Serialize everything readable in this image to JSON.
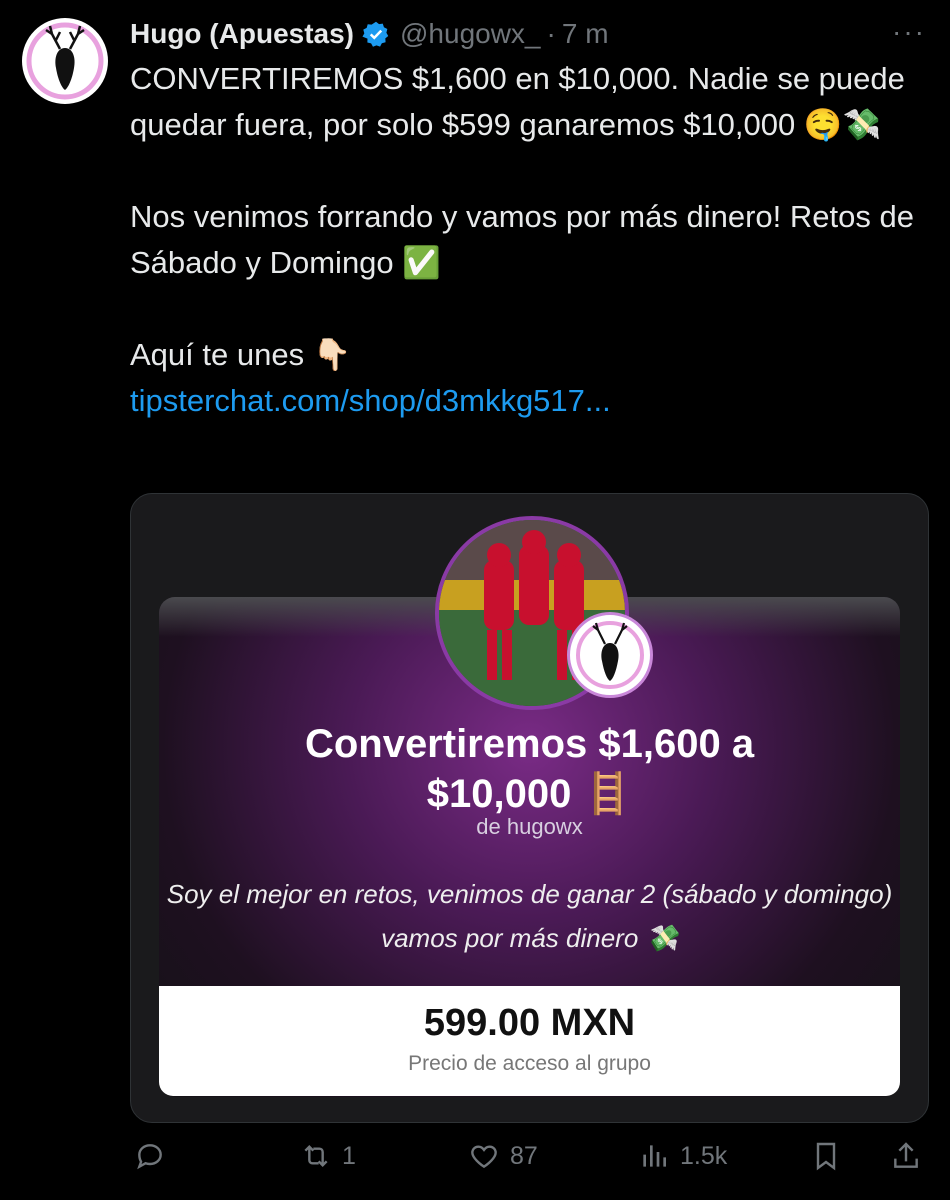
{
  "author": {
    "name": "Hugo (Apuestas)",
    "handle": "@hugowx_",
    "separator": "·",
    "time": "7 m",
    "verified": true,
    "avatar_icon": "deer-logo-icon"
  },
  "more_label": "···",
  "tweet": {
    "text": "CONVERTIREMOS $1,600 en $10,000. Nadie se puede quedar fuera, por solo $599 ganaremos $10,000 🤤💸\n\nNos venimos forrando y vamos por más dinero! Retos de Sábado y Domingo ✅\n\nAquí te unes 👇🏻",
    "link": "tipsterchat.com/shop/d3mkkg517..."
  },
  "card": {
    "title_line1": "Convertiremos $1,600 a",
    "title_line2": "$10,000 🪜",
    "by": "de hugowx",
    "description": "Soy el mejor en retos, venimos de ganar 2 (sábado y domingo) vamos por más dinero 💸",
    "price": "599.00 MXN",
    "price_label": "Precio de acceso al grupo"
  },
  "actions": {
    "replies": "",
    "retweets": "1",
    "likes": "87",
    "views": "1.5k"
  },
  "colors": {
    "background": "#000000",
    "text": "#e7e9ea",
    "muted": "#71767b",
    "link": "#1d9bf0",
    "verified": "#1d9bf0",
    "card_purple": "#7a2b86"
  }
}
